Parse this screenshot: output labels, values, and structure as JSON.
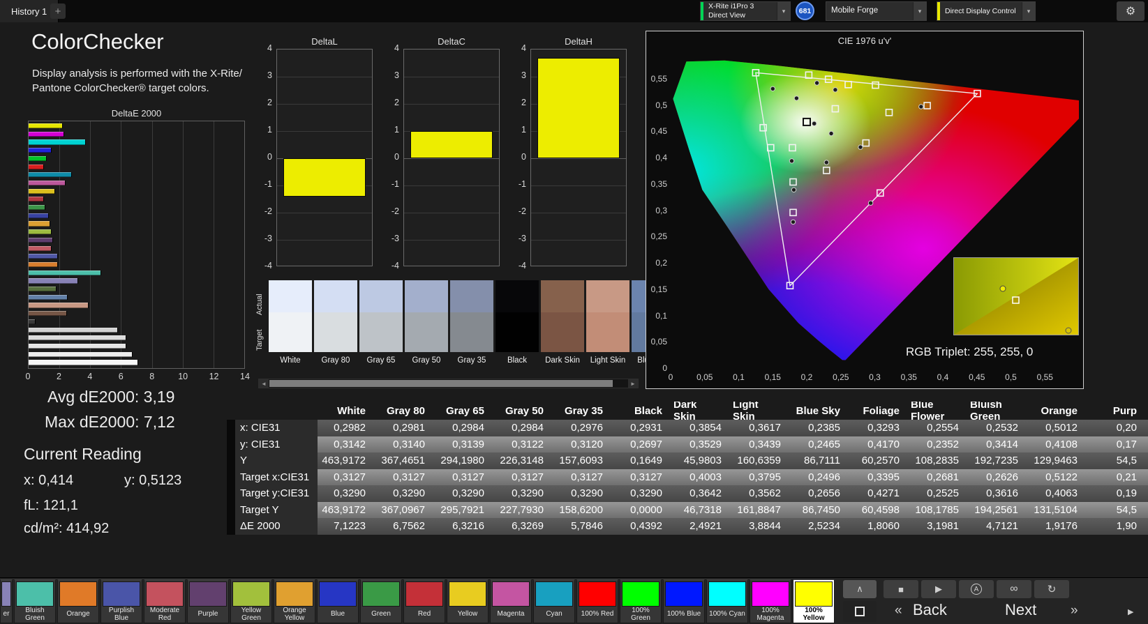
{
  "topbar": {
    "tab_label": "History 1",
    "add_tab_label": "+",
    "chevron": "▾",
    "gear_icon": "⚙",
    "badge_value": "681",
    "meter_dropdown": {
      "line1": "X-Rite i1Pro 3",
      "line2": "Direct View",
      "accent_color": "#00d455"
    },
    "pattern_dropdown": {
      "label": "Mobile Forge"
    },
    "display_dropdown": {
      "label": "Direct Display Control",
      "accent_color": "#e8e800"
    }
  },
  "left_panel": {
    "title": "ColorChecker",
    "description": "Display analysis is performed with the X-Rite/ Pantone ColorChecker® target colors.",
    "avg_de": "Avg dE2000: 3,19",
    "max_de": "Max dE2000: 7,12",
    "current_reading_label": "Current Reading",
    "reading_x": "x: 0,414",
    "reading_y": "y: 0,5123",
    "reading_fl": "fL: 121,1",
    "reading_cdm2": "cd/m²: 414,92"
  },
  "chart_data": [
    {
      "id": "deltaE2000",
      "type": "bar",
      "orientation": "horizontal",
      "title": "DeltaE 2000",
      "xlim": [
        0,
        14
      ],
      "xticks": [
        0,
        2,
        4,
        6,
        8,
        10,
        12,
        14
      ],
      "bars": [
        {
          "label": "100% Yellow",
          "value": 2.2,
          "color": "#e6e600"
        },
        {
          "label": "100% Magenta",
          "value": 2.3,
          "color": "#d400d4"
        },
        {
          "label": "100% Cyan",
          "value": 3.7,
          "color": "#00d2d2"
        },
        {
          "label": "100% Blue",
          "value": 1.5,
          "color": "#2222dc"
        },
        {
          "label": "100% Green",
          "value": 1.2,
          "color": "#00c428"
        },
        {
          "label": "100% Red",
          "value": 1.0,
          "color": "#d81e1e"
        },
        {
          "label": "Cyan",
          "value": 2.8,
          "color": "#0e8ca8"
        },
        {
          "label": "Magenta",
          "value": 2.4,
          "color": "#bc589c"
        },
        {
          "label": "Yellow",
          "value": 1.7,
          "color": "#dcc01e"
        },
        {
          "label": "Red",
          "value": 1.0,
          "color": "#b23640"
        },
        {
          "label": "Green",
          "value": 1.1,
          "color": "#3c9448"
        },
        {
          "label": "Blue",
          "value": 1.3,
          "color": "#3842a2"
        },
        {
          "label": "Orange Yellow",
          "value": 1.4,
          "color": "#dca032"
        },
        {
          "label": "Yellow Green",
          "value": 1.5,
          "color": "#9cbc40"
        },
        {
          "label": "Purple",
          "value": 1.6,
          "color": "#5e3e6e"
        },
        {
          "label": "Moderate Red",
          "value": 1.5,
          "color": "#c25a64"
        },
        {
          "label": "Purplish Blue",
          "value": 1.9,
          "color": "#5058a6"
        },
        {
          "label": "Orange",
          "value": 1.9176,
          "color": "#d87e2e"
        },
        {
          "label": "Bluish Green",
          "value": 4.7121,
          "color": "#4cbfaa"
        },
        {
          "label": "Blue Flower",
          "value": 3.1981,
          "color": "#8882b6"
        },
        {
          "label": "Foliage",
          "value": 1.806,
          "color": "#58703e"
        },
        {
          "label": "Blue Sky",
          "value": 2.5234,
          "color": "#6280a8"
        },
        {
          "label": "Light Skin",
          "value": 3.8844,
          "color": "#c89884"
        },
        {
          "label": "Dark Skin",
          "value": 2.4921,
          "color": "#765646"
        },
        {
          "label": "Black",
          "value": 0.4392,
          "color": "#3a3a3a"
        },
        {
          "label": "Gray 35",
          "value": 5.7846,
          "color": "#d2d2d2"
        },
        {
          "label": "Gray 50",
          "value": 6.3269,
          "color": "#dcdcdc"
        },
        {
          "label": "Gray 65",
          "value": 6.3216,
          "color": "#e4e4e4"
        },
        {
          "label": "Gray 80",
          "value": 6.7562,
          "color": "#ededed"
        },
        {
          "label": "White",
          "value": 7.1223,
          "color": "#f6f6f6"
        }
      ]
    },
    {
      "id": "deltaL",
      "type": "bar",
      "title": "DeltaL",
      "ylim": [
        -4,
        4
      ],
      "yticks": [
        4,
        3,
        2,
        1,
        0,
        -1,
        -2,
        -3,
        -4
      ],
      "value": -1.4,
      "bar_color": "#eded00"
    },
    {
      "id": "deltaC",
      "type": "bar",
      "title": "DeltaC",
      "ylim": [
        -4,
        4
      ],
      "yticks": [
        4,
        3,
        2,
        1,
        0,
        -1,
        -2,
        -3,
        -4
      ],
      "value": 1.0,
      "bar_color": "#eded00"
    },
    {
      "id": "deltaH",
      "type": "bar",
      "title": "DeltaH",
      "ylim": [
        -4,
        4
      ],
      "yticks": [
        4,
        3,
        2,
        1,
        0,
        -1,
        -2,
        -3,
        -4
      ],
      "value": 3.7,
      "bar_color": "#eded00"
    },
    {
      "id": "cie1976",
      "type": "scatter",
      "title": "CIE 1976 u'v'",
      "rgb_triplet": "RGB Triplet: 255, 255, 0",
      "xlim": [
        0,
        0.6
      ],
      "ylim": [
        0,
        0.6
      ],
      "xticks": [
        "0",
        "0,05",
        "0,1",
        "0,15",
        "0,2",
        "0,25",
        "0,3",
        "0,35",
        "0,4",
        "0,45",
        "0,5",
        "0,55"
      ],
      "yticks": [
        "0",
        "0,05",
        "0,1",
        "0,15",
        "0,2",
        "0,25",
        "0,3",
        "0,35",
        "0,4",
        "0,45",
        "0,5",
        "0,55"
      ],
      "gamut_triangle": [
        [
          0.4507,
          0.5229
        ],
        [
          0.125,
          0.5625
        ],
        [
          0.1754,
          0.1579
        ]
      ],
      "spectral_locus": [
        [
          0.2568,
          0.0166
        ],
        [
          0.2522,
          0.0169
        ],
        [
          0.2347,
          0.035
        ],
        [
          0.2161,
          0.0549
        ],
        [
          0.1877,
          0.0871
        ],
        [
          0.1441,
          0.151
        ],
        [
          0.0828,
          0.2708
        ],
        [
          0.0466,
          0.34
        ],
        [
          0.0282,
          0.4117
        ],
        [
          0.0035,
          0.513
        ],
        [
          0.0231,
          0.5837
        ],
        [
          0.0792,
          0.5857
        ],
        [
          0.1531,
          0.5766
        ],
        [
          0.2623,
          0.5604
        ],
        [
          0.4035,
          0.5393
        ],
        [
          0.5203,
          0.5219
        ],
        [
          0.6234,
          0.5065
        ]
      ],
      "reference_square": [
        0.2,
        0.469
      ],
      "targets": [
        [
          0.125,
          0.5625
        ],
        [
          0.203,
          0.558
        ],
        [
          0.232,
          0.55
        ],
        [
          0.261,
          0.54
        ],
        [
          0.301,
          0.539
        ],
        [
          0.4507,
          0.5229
        ],
        [
          0.377,
          0.5
        ],
        [
          0.321,
          0.487
        ],
        [
          0.242,
          0.494
        ],
        [
          0.136,
          0.458
        ],
        [
          0.147,
          0.42
        ],
        [
          0.179,
          0.42
        ],
        [
          0.287,
          0.429
        ],
        [
          0.229,
          0.377
        ],
        [
          0.18,
          0.355
        ],
        [
          0.308,
          0.334
        ],
        [
          0.18,
          0.297
        ],
        [
          0.1754,
          0.158
        ]
      ],
      "measurements": [
        [
          0.15,
          0.532
        ],
        [
          0.185,
          0.514
        ],
        [
          0.215,
          0.543
        ],
        [
          0.242,
          0.53
        ],
        [
          0.211,
          0.466
        ],
        [
          0.368,
          0.498
        ],
        [
          0.279,
          0.421
        ],
        [
          0.178,
          0.395
        ],
        [
          0.229,
          0.392
        ],
        [
          0.181,
          0.34
        ],
        [
          0.294,
          0.315
        ],
        [
          0.18,
          0.279
        ],
        [
          0.236,
          0.447
        ]
      ]
    }
  ],
  "swatch_strip": {
    "row_labels": [
      "Actual",
      "Target"
    ],
    "scroll_left_icon": "◄",
    "scroll_right_icon": "►",
    "items": [
      {
        "label": "White",
        "actual": "#e6edfb",
        "target": "#eff2f5"
      },
      {
        "label": "Gray 80",
        "actual": "#d4def3",
        "target": "#d9dde0"
      },
      {
        "label": "Gray 65",
        "actual": "#bdc9e3",
        "target": "#bec3c8"
      },
      {
        "label": "Gray 50",
        "actual": "#a3afcc",
        "target": "#a4aab0"
      },
      {
        "label": "Gray 35",
        "actual": "#848fab",
        "target": "#858a90"
      },
      {
        "label": "Black",
        "actual": "#070709",
        "target": "#010101"
      },
      {
        "label": "Dark Skin",
        "actual": "#86614c",
        "target": "#7b5544"
      },
      {
        "label": "Light Skin",
        "actual": "#c89985",
        "target": "#c28d77"
      },
      {
        "label": "Blue Sky",
        "actual": "#6b84ae",
        "target": "#627a9f"
      }
    ]
  },
  "table": {
    "columns": [
      "White",
      "Gray 80",
      "Gray 65",
      "Gray 50",
      "Gray 35",
      "Black",
      "Dark Skin",
      "Light Skin",
      "Blue Sky",
      "Foliage",
      "Blue Flower",
      "Bluish Green",
      "Orange",
      "Purp"
    ],
    "rows": [
      {
        "label": "x: CIE31",
        "values": [
          "0,2982",
          "0,2981",
          "0,2984",
          "0,2984",
          "0,2976",
          "0,2931",
          "0,3854",
          "0,3617",
          "0,2385",
          "0,3293",
          "0,2554",
          "0,2532",
          "0,5012",
          "0,20"
        ]
      },
      {
        "label": "y: CIE31",
        "values": [
          "0,3142",
          "0,3140",
          "0,3139",
          "0,3122",
          "0,3120",
          "0,2697",
          "0,3529",
          "0,3439",
          "0,2465",
          "0,4170",
          "0,2352",
          "0,3414",
          "0,4108",
          "0,17"
        ]
      },
      {
        "label": "Y",
        "values": [
          "463,9172",
          "367,4651",
          "294,1980",
          "226,3148",
          "157,6093",
          "0,1649",
          "45,9803",
          "160,6359",
          "86,7111",
          "60,2570",
          "108,2835",
          "192,7235",
          "129,9463",
          "54,5"
        ]
      },
      {
        "label": "Target x:CIE31",
        "values": [
          "0,3127",
          "0,3127",
          "0,3127",
          "0,3127",
          "0,3127",
          "0,3127",
          "0,4003",
          "0,3795",
          "0,2496",
          "0,3395",
          "0,2681",
          "0,2626",
          "0,5122",
          "0,21"
        ]
      },
      {
        "label": "Target y:CIE31",
        "values": [
          "0,3290",
          "0,3290",
          "0,3290",
          "0,3290",
          "0,3290",
          "0,3290",
          "0,3642",
          "0,3562",
          "0,2656",
          "0,4271",
          "0,2525",
          "0,3616",
          "0,4063",
          "0,19"
        ]
      },
      {
        "label": "Target Y",
        "values": [
          "463,9172",
          "367,0967",
          "295,7921",
          "227,7930",
          "158,6200",
          "0,0000",
          "46,7318",
          "161,8847",
          "86,7450",
          "60,4598",
          "108,1785",
          "194,2561",
          "131,5104",
          "54,5"
        ]
      },
      {
        "label": "ΔE 2000",
        "values": [
          "7,1223",
          "6,7562",
          "6,3216",
          "6,3269",
          "5,7846",
          "0,4392",
          "2,4921",
          "3,8844",
          "2,5234",
          "1,8060",
          "3,1981",
          "4,7121",
          "1,9176",
          "1,90"
        ]
      }
    ]
  },
  "palette": {
    "items": [
      {
        "label": "er",
        "color": "#8882b6",
        "partial": true
      },
      {
        "label": "Bluish Green",
        "color": "#4cbfa9"
      },
      {
        "label": "Orange",
        "color": "#e07a28"
      },
      {
        "label": "Purplish Blue",
        "color": "#4a55a8"
      },
      {
        "label": "Moderate Red",
        "color": "#c4525e"
      },
      {
        "label": "Purple",
        "color": "#62406e"
      },
      {
        "label": "Yellow Green",
        "color": "#a2c03c"
      },
      {
        "label": "Orange Yellow",
        "color": "#e0a030"
      },
      {
        "label": "Blue",
        "color": "#2636c4"
      },
      {
        "label": "Green",
        "color": "#3a9a46"
      },
      {
        "label": "Red",
        "color": "#c43038"
      },
      {
        "label": "Yellow",
        "color": "#e8cc20"
      },
      {
        "label": "Magenta",
        "color": "#c455a2"
      },
      {
        "label": "Cyan",
        "color": "#18a0c0"
      },
      {
        "label": "100% Red",
        "color": "#ff0000"
      },
      {
        "label": "100% Green",
        "color": "#00ff00"
      },
      {
        "label": "100% Blue",
        "color": "#0018ff"
      },
      {
        "label": "100% Cyan",
        "color": "#00ffff"
      },
      {
        "label": "100% Magenta",
        "color": "#ff00ff"
      },
      {
        "label": "100% Yellow",
        "color": "#ffff00",
        "selected": true
      }
    ]
  },
  "transport": {
    "up_icon": "∧",
    "stop_icon": "■",
    "play_icon": "▶",
    "save_icon": "A",
    "loop_icon": "∞",
    "refresh_icon": "↻",
    "back_chevron": "«",
    "back_label": "Back",
    "next_label": "Next",
    "next_chevron": "»",
    "scroll_right_icon": "▶"
  }
}
